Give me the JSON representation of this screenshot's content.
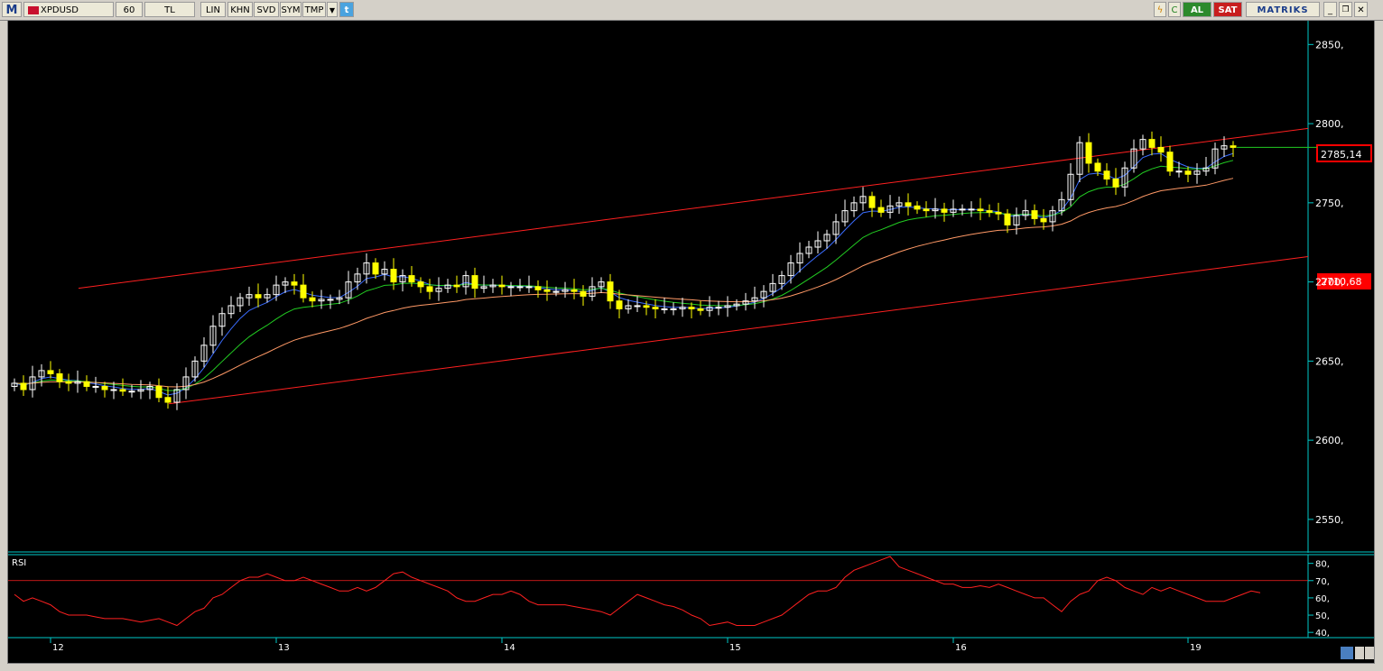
{
  "toolbar": {
    "app_icon": "M",
    "symbol": "XPDUSD",
    "interval": "60",
    "currency": "TL",
    "scale": "LIN",
    "buttons": [
      "KHN",
      "SVD",
      "SYM",
      "TMP"
    ],
    "buy_label": "AL",
    "sell_label": "SAT",
    "brand": "MATRIKS",
    "icons": [
      "flag-icon",
      "dropdown-icon",
      "twitter-icon",
      "lightning-icon",
      "refresh-icon",
      "minimize-icon",
      "restore-icon",
      "close-icon"
    ]
  },
  "colors": {
    "background": "#000000",
    "axis": "#00c8c8",
    "bull_candle": "#ffffff",
    "bear_candle": "#ffff00",
    "ma_fast": "#3a6cff",
    "ma_mid": "#22cc22",
    "ma_slow": "#ff9966",
    "trend": "#ff2020",
    "rsi": "#ff2020"
  },
  "price_panel": {
    "y_ticks": [
      "2850,",
      "2800,",
      "2750,",
      "2700,",
      "2650,",
      "2600,",
      "2550,"
    ],
    "last_price_label": "2785,14",
    "level_label": "2710,68"
  },
  "rsi_panel": {
    "title": "RSI",
    "y_ticks": [
      "80,",
      "70,",
      "60,",
      "50,",
      "40,"
    ],
    "overbought": 70
  },
  "x_axis": {
    "dates": [
      "12",
      "13",
      "14",
      "15",
      "16",
      "19"
    ]
  },
  "chart_data": {
    "type": "candlestick",
    "symbol": "XPDUSD",
    "interval": "60",
    "y_range": [
      2530,
      2865
    ],
    "rsi_range": [
      38,
      84
    ],
    "closes": [
      2636,
      2632,
      2640,
      2644,
      2642,
      2637,
      2636,
      2637,
      2634,
      2634,
      2632,
      2632,
      2631,
      2631,
      2632,
      2634,
      2627,
      2624,
      2632,
      2640,
      2650,
      2660,
      2672,
      2680,
      2685,
      2690,
      2692,
      2690,
      2692,
      2698,
      2700,
      2698,
      2690,
      2688,
      2689,
      2689,
      2690,
      2700,
      2705,
      2712,
      2705,
      2708,
      2700,
      2704,
      2700,
      2697,
      2694,
      2696,
      2698,
      2697,
      2704,
      2696,
      2697,
      2698,
      2697,
      2697,
      2697,
      2697,
      2695,
      2694,
      2694,
      2695,
      2694,
      2691,
      2697,
      2700,
      2688,
      2683,
      2685,
      2685,
      2684,
      2683,
      2683,
      2683,
      2684,
      2683,
      2682,
      2684,
      2684,
      2685,
      2686,
      2688,
      2690,
      2694,
      2699,
      2704,
      2712,
      2718,
      2722,
      2726,
      2730,
      2738,
      2745,
      2750,
      2754,
      2747,
      2744,
      2748,
      2750,
      2748,
      2746,
      2745,
      2746,
      2744,
      2746,
      2746,
      2746,
      2745,
      2744,
      2743,
      2736,
      2742,
      2745,
      2740,
      2738,
      2745,
      2752,
      2768,
      2788,
      2775,
      2770,
      2765,
      2760,
      2772,
      2784,
      2790,
      2785,
      2782,
      2770,
      2770,
      2768,
      2770,
      2772,
      2784,
      2786,
      2785
    ],
    "rsi": [
      62,
      58,
      60,
      58,
      56,
      52,
      50,
      50,
      50,
      49,
      48,
      48,
      48,
      47,
      46,
      47,
      48,
      46,
      44,
      48,
      52,
      54,
      60,
      62,
      66,
      70,
      72,
      72,
      74,
      72,
      70,
      70,
      72,
      70,
      68,
      66,
      64,
      64,
      66,
      64,
      66,
      70,
      74,
      75,
      72,
      70,
      68,
      66,
      64,
      60,
      58,
      58,
      60,
      62,
      62,
      64,
      62,
      58,
      56,
      56,
      56,
      56,
      55,
      54,
      53,
      52,
      50,
      54,
      58,
      62,
      60,
      58,
      56,
      55,
      53,
      50,
      48,
      44,
      45,
      46,
      44,
      44,
      44,
      46,
      48,
      50,
      54,
      58,
      62,
      64,
      64,
      66,
      72,
      76,
      78,
      80,
      82,
      84,
      78,
      76,
      74,
      72,
      70,
      68,
      68,
      66,
      66,
      67,
      66,
      68,
      66,
      64,
      62,
      60,
      60,
      56,
      52,
      58,
      62,
      64,
      70,
      72,
      70,
      66,
      64,
      62,
      66,
      64,
      66,
      64,
      62,
      60,
      58,
      58,
      58,
      60,
      62,
      64,
      63
    ]
  }
}
